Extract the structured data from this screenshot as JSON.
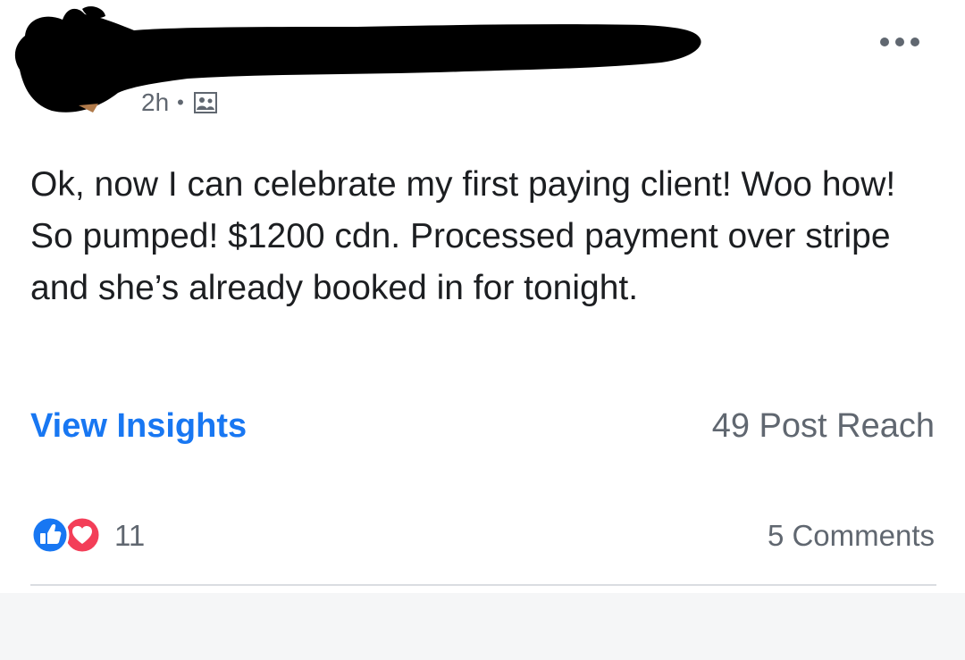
{
  "post": {
    "time": "2h",
    "separator": "•",
    "audience_icon": "friends-icon",
    "more_icon": "more-options-icon",
    "body_text": "Ok, now I can celebrate my first paying client! Woo how! So pumped! $1200 cdn. Processed payment over stripe and she’s already booked in for tonight.",
    "view_insights": "View Insights",
    "post_reach": "49 Post Reach",
    "reaction_icons": [
      "like-icon",
      "love-icon"
    ],
    "reaction_count": "11",
    "comments": "5 Comments"
  },
  "colors": {
    "link_blue": "#1877f2",
    "secondary_text": "#606770",
    "love_red": "#f33e58",
    "redaction": "#000000"
  }
}
